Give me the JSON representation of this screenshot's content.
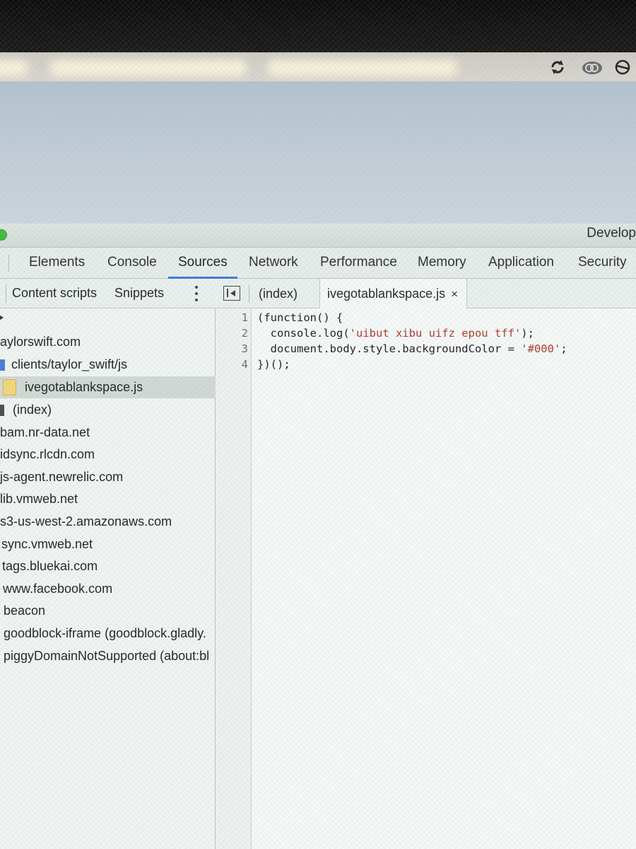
{
  "window": {
    "title": "Develop"
  },
  "browser": {
    "extensions": [
      {
        "icon": "reload-icon"
      },
      {
        "icon": "creative-cloud-icon"
      },
      {
        "icon": "block-icon"
      }
    ]
  },
  "devtools": {
    "tabs": [
      {
        "label": "Elements",
        "active": false
      },
      {
        "label": "Console",
        "active": false
      },
      {
        "label": "Sources",
        "active": true
      },
      {
        "label": "Network",
        "active": false
      },
      {
        "label": "Performance",
        "active": false
      },
      {
        "label": "Memory",
        "active": false
      },
      {
        "label": "Application",
        "active": false
      },
      {
        "label": "Security",
        "active": false
      }
    ],
    "accent": "#3a7bd5"
  },
  "navigator": {
    "tabs": [
      {
        "label": "Content scripts"
      },
      {
        "label": "Snippets"
      }
    ],
    "tree": [
      {
        "label": "aylorswift.com",
        "icon": "domain-arrow"
      },
      {
        "label": "clients/taylor_swift/js",
        "icon": "folder-icon"
      },
      {
        "label": "ivegotablankspace.js",
        "icon": "js-file-icon",
        "selected": true
      },
      {
        "label": "(index)",
        "icon": "document-icon"
      },
      {
        "label": "bam.nr-data.net"
      },
      {
        "label": "idsync.rlcdn.com"
      },
      {
        "label": "js-agent.newrelic.com"
      },
      {
        "label": "lib.vmweb.net"
      },
      {
        "label": "s3-us-west-2.amazonaws.com"
      },
      {
        "label": "sync.vmweb.net"
      },
      {
        "label": "tags.bluekai.com"
      },
      {
        "label": "www.facebook.com"
      },
      {
        "label": "beacon"
      },
      {
        "label": "goodblock-iframe (goodblock.gladly."
      },
      {
        "label": "piggyDomainNotSupported (about:bl"
      }
    ]
  },
  "editor": {
    "tabs": [
      {
        "label": "(index)",
        "active": false
      },
      {
        "label": "ivegotablankspace.js",
        "active": true,
        "close": "×"
      }
    ],
    "lines": [
      {
        "num": "1",
        "text": "(function() {",
        "string": ""
      },
      {
        "num": "2",
        "text": "  console.log(",
        "string": "'uibut xibu uifz epou tff'",
        "tail": ");"
      },
      {
        "num": "3",
        "text": "  document.body.style.backgroundColor = ",
        "string": "'#000'",
        "tail": ";"
      },
      {
        "num": "4",
        "text": "})();",
        "string": ""
      }
    ]
  }
}
